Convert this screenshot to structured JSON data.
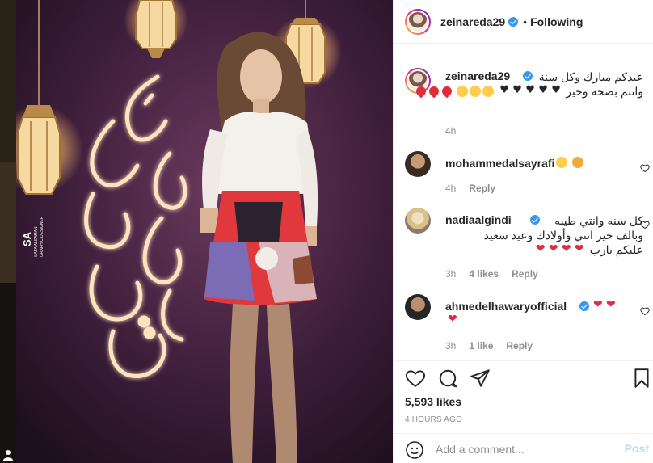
{
  "post": {
    "username": "zeinareda29",
    "following_label": "Following",
    "dot": "•"
  },
  "caption": {
    "username": "zeinareda29",
    "line1": "عيدكم مبارك وكل سنة",
    "line2": "وانتم بصحة وخير",
    "time": "4h"
  },
  "comments": [
    {
      "username": "mohammedalsayrafi",
      "text": "",
      "time": "4h",
      "likes": "",
      "reply": "Reply"
    },
    {
      "username": "nadiaalgindi",
      "line1": "كل سنه وانتي طيبه",
      "line2": "وبالف خير انتي وأولادك وعيد سعيد",
      "line3": "عليكم يارب",
      "time": "3h",
      "likes": "4 likes",
      "reply": "Reply"
    },
    {
      "username": "ahmedelhawaryofficial",
      "text": "",
      "time": "3h",
      "likes": "1 like",
      "reply": "Reply"
    }
  ],
  "likes_count": "5,593 likes",
  "posted_ago": "4 HOURS AGO",
  "add_comment": {
    "placeholder": "Add a comment...",
    "post_label": "Post"
  },
  "icons": {
    "like": "heart-icon",
    "comment": "comment-icon",
    "share": "share-icon",
    "save": "bookmark-icon",
    "emoji": "smiley-icon"
  },
  "image_text": {
    "watermark_initials": "SA",
    "watermark_line1": "SAFA ALSAMAN",
    "watermark_line2": "GRAPHIC DESIGNER"
  },
  "colors": {
    "accent": "#3897f0",
    "post_disabled": "#b2dffc",
    "heart": "#ed4956"
  }
}
